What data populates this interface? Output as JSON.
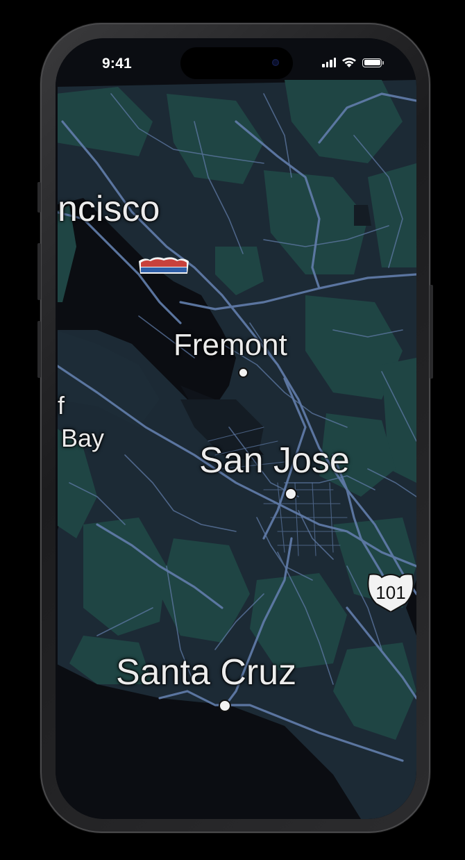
{
  "status_bar": {
    "time": "9:41"
  },
  "map": {
    "theme": "dark",
    "colors": {
      "water": "#0b0d12",
      "land": "#1c2a35",
      "forest": "#1f4544",
      "road": "#5f7aa6"
    },
    "place_labels": [
      {
        "id": "san-francisco",
        "text": "ncisco"
      },
      {
        "id": "fremont",
        "text": "Fremont"
      },
      {
        "id": "san-jose",
        "text": "San Jose"
      },
      {
        "id": "santa-cruz",
        "text": "Santa Cruz"
      },
      {
        "id": "half-moon-bay-a",
        "text": "f"
      },
      {
        "id": "half-moon-bay-b",
        "text": "Bay"
      }
    ],
    "highway_shield": {
      "route": "101",
      "icon": "us-highway-shield-icon"
    },
    "interstate_shield": {
      "icon": "interstate-shield-icon"
    }
  }
}
